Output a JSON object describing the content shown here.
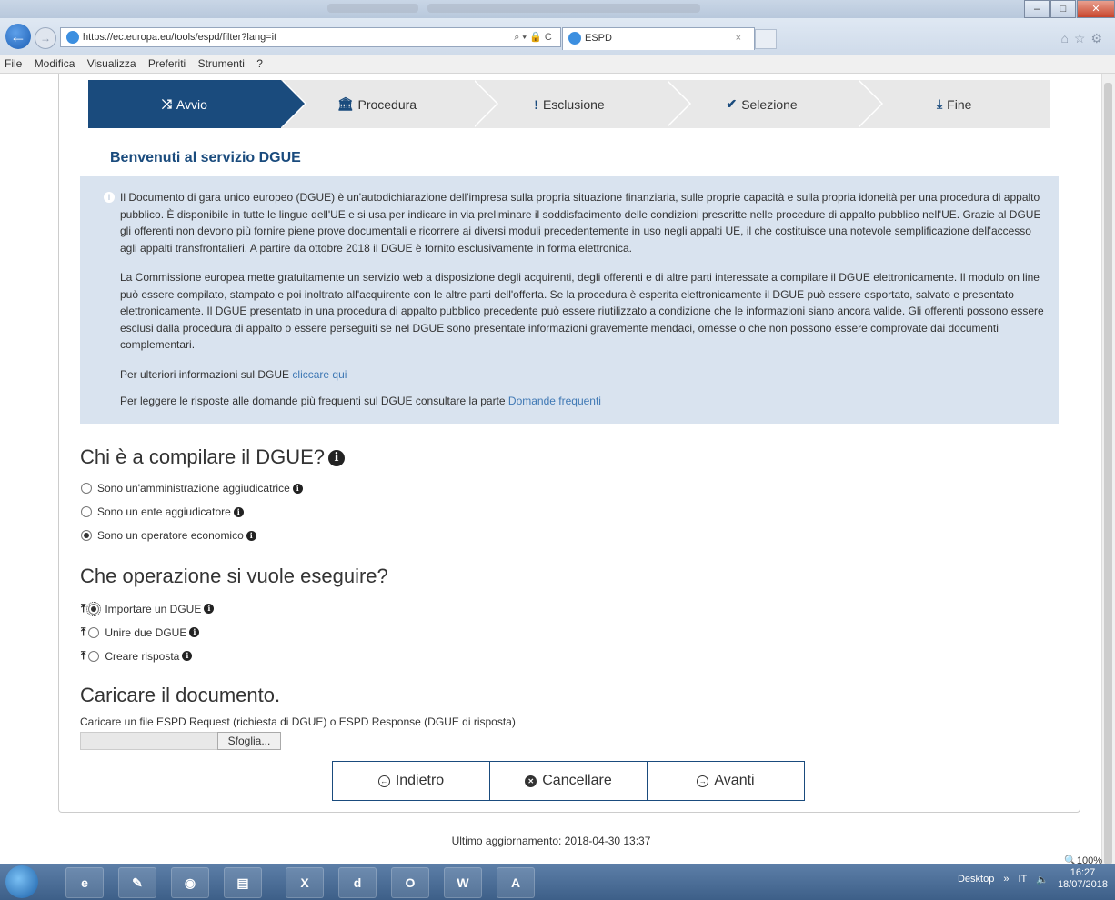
{
  "browser": {
    "url": "https://ec.europa.eu/tools/espd/filter?lang=it",
    "url_controls": "⌕ ▾ 🔒 C",
    "tab_title": "ESPD",
    "tab_close": "×",
    "menu": [
      "File",
      "Modifica",
      "Visualizza",
      "Preferiti",
      "Strumenti",
      "?"
    ],
    "zoom": "100%"
  },
  "wizard": {
    "steps": [
      {
        "icon": "⤨",
        "label": "Avvio"
      },
      {
        "icon": "🏛",
        "label": "Procedura"
      },
      {
        "icon": "!",
        "label": "Esclusione"
      },
      {
        "icon": "✔",
        "label": "Selezione"
      },
      {
        "icon": "⤓",
        "label": "Fine"
      }
    ]
  },
  "welcome_title": "Benvenuti al servizio DGUE",
  "info": {
    "p1": "Il Documento di gara unico europeo (DGUE) è un'autodichiarazione dell'impresa sulla propria situazione finanziaria, sulle proprie capacità e sulla propria idoneità per una procedura di appalto pubblico. È disponibile in tutte le lingue dell'UE e si usa per indicare in via preliminare il soddisfacimento delle condizioni prescritte nelle procedure di appalto pubblico nell'UE. Grazie al DGUE gli offerenti non devono più fornire piene prove documentali e ricorrere ai diversi moduli precedentemente in uso negli appalti UE, il che costituisce una notevole semplificazione dell'accesso agli appalti transfrontalieri. A partire da ottobre 2018 il DGUE è fornito esclusivamente in forma elettronica.",
    "p2": "La Commissione europea mette gratuitamente un servizio web a disposizione degli acquirenti, degli offerenti e di altre parti interessate a compilare il DGUE elettronicamente. Il modulo on line può essere compilato, stampato e poi inoltrato all'acquirente con le altre parti dell'offerta. Se la procedura è esperita elettronicamente il DGUE può essere esportato, salvato e presentato elettronicamente. Il DGUE presentato in una procedura di appalto pubblico precedente può essere riutilizzato a condizione che le informazioni siano ancora valide. Gli offerenti possono essere esclusi dalla procedura di appalto o essere perseguiti se nel DGUE sono presentate informazioni gravemente mendaci, omesse o che non possono essere comprovate dai documenti complementari.",
    "p3_text": "Per ulteriori informazioni sul DGUE ",
    "p3_link": "cliccare qui",
    "p4_text": "Per leggere le risposte alle domande più frequenti sul DGUE consultare la parte ",
    "p4_link": "Domande frequenti"
  },
  "who": {
    "heading": "Chi è a compilare il DGUE?",
    "options": [
      {
        "label": "Sono un'amministrazione aggiudicatrice",
        "selected": false
      },
      {
        "label": "Sono un ente aggiudicatore",
        "selected": false
      },
      {
        "label": "Sono un operatore economico",
        "selected": true
      }
    ]
  },
  "operation": {
    "heading": "Che operazione si vuole eseguire?",
    "options": [
      {
        "label": "Importare un DGUE",
        "selected": true
      },
      {
        "label": "Unire due DGUE",
        "selected": false
      },
      {
        "label": "Creare risposta",
        "selected": false
      }
    ]
  },
  "upload": {
    "heading": "Caricare il documento.",
    "label": "Caricare un file ESPD Request (richiesta di DGUE) o ESPD Response (DGUE di risposta)",
    "browse_button": "Sfoglia..."
  },
  "buttons": {
    "back": "Indietro",
    "cancel": "Cancellare",
    "next": "Avanti"
  },
  "footer": "Ultimo aggiornamento: 2018-04-30 13:37",
  "taskbar": {
    "desktop_label": "Desktop",
    "lang": "IT",
    "time": "16:27",
    "date": "18/07/2018"
  }
}
